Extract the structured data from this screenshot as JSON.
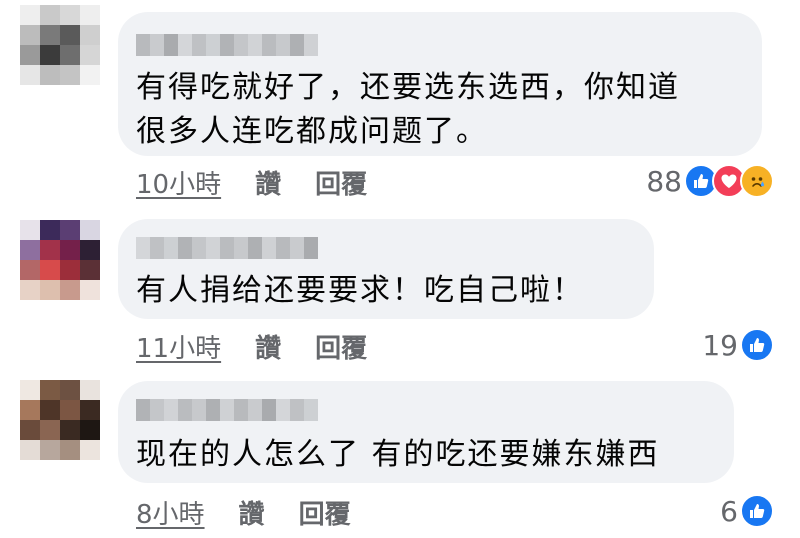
{
  "comments": [
    {
      "text": "有得吃就好了，还要选东选西，你知道\n很多人连吃都成问题了。",
      "time": "10小時",
      "like_label": "讚",
      "reply_label": "回覆",
      "reaction_count": "88",
      "reactions": [
        "like-icon",
        "love-icon",
        "sad-icon"
      ],
      "avatar_colors": [
        "#eeeeee",
        "#c9c9c9",
        "#d8d8d8",
        "#eeeeee",
        "#bcbcbc",
        "#7a7a7a",
        "#5a5a5a",
        "#cfcfcf",
        "#9a9a9a",
        "#3b3b3b",
        "#6e6e6e",
        "#d6d6d6",
        "#e6e6e6",
        "#bdbdbd",
        "#c4c4c4",
        "#f2f2f2"
      ]
    },
    {
      "text": "有人捐给还要要求！吃自己啦！",
      "time": "11小時",
      "like_label": "讚",
      "reply_label": "回覆",
      "reaction_count": "19",
      "reactions": [
        "like-icon"
      ],
      "avatar_colors": [
        "#e7e2ea",
        "#3c2a5a",
        "#5b3e73",
        "#d9d6e2",
        "#8e6f9f",
        "#a2324a",
        "#74204a",
        "#2d2034",
        "#b36767",
        "#d74b4b",
        "#9c2e3a",
        "#5b3036",
        "#e7d2c6",
        "#ddbfae",
        "#c89a8d",
        "#efe2dc"
      ]
    },
    {
      "text": "现在的人怎么了 有的吃还要嫌东嫌西",
      "time": "8小時",
      "like_label": "讚",
      "reply_label": "回覆",
      "reaction_count": "6",
      "reactions": [
        "like-icon"
      ],
      "avatar_colors": [
        "#efe8e2",
        "#7b5a44",
        "#6d5142",
        "#e9e3de",
        "#a6785c",
        "#4e3528",
        "#7c5643",
        "#3b2a22",
        "#6a4b3b",
        "#8a6552",
        "#3a2a22",
        "#1e1713",
        "#e4dcd6",
        "#b7a79d",
        "#a58f80",
        "#ece4de"
      ]
    }
  ]
}
